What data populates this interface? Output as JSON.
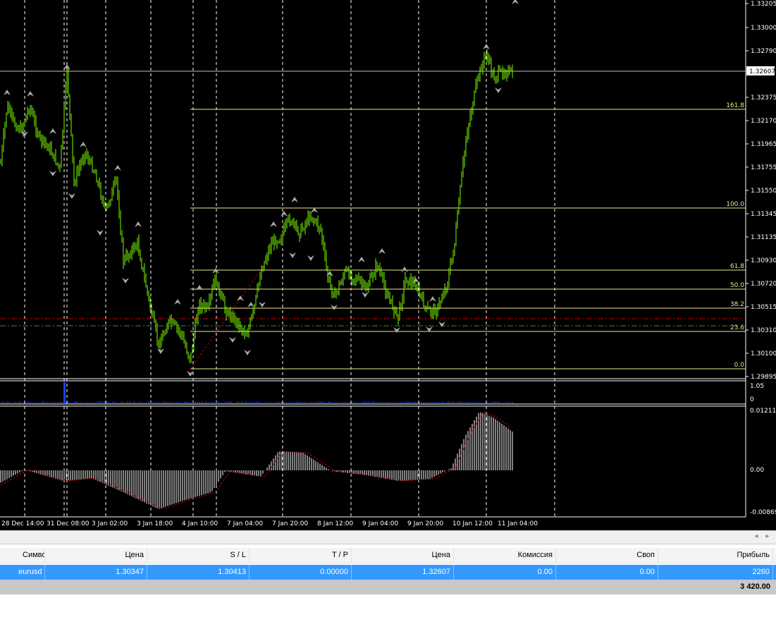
{
  "chart": {
    "price_axis_labels": [
      "1.33205",
      "1.33000",
      "1.32790",
      "1.32375",
      "1.32170",
      "1.31965",
      "1.31755",
      "1.31550",
      "1.31345",
      "1.31135",
      "1.30930",
      "1.30720",
      "1.30515",
      "1.30310",
      "1.30100",
      "1.29895"
    ],
    "current_price": "1.32607",
    "volume_axis_labels": [
      "1.05",
      "0"
    ],
    "indicator_axis_labels": [
      "0.012113",
      "0.00",
      "-0.00869"
    ],
    "time_axis_labels": [
      "28 Dec 14:00",
      "31 Dec 08:00",
      "3 Jan 02:00",
      "3 Jan 18:00",
      "4 Jan 10:00",
      "7 Jan 04:00",
      "7 Jan 20:00",
      "8 Jan 12:00",
      "9 Jan 04:00",
      "9 Jan 20:00",
      "10 Jan 12:00",
      "11 Jan 04:00"
    ],
    "fibonacci_levels": [
      "161.8",
      "100.0",
      "61.8",
      "50.0",
      "38.2",
      "23.6",
      "0.0"
    ],
    "colors": {
      "background": "#000000",
      "candles": "#7cfc00",
      "grid": "#ffffff",
      "fib": "#f0e68c",
      "macd_bars": "#ffffff",
      "signal": "#cc0000",
      "selected_row": "#3399ff"
    }
  },
  "scrollbar": {
    "left_icon": "arrow-left-icon",
    "right_icon": "arrow-right-icon",
    "left_glyph": "◂",
    "right_glyph": "▸"
  },
  "terminal": {
    "columns": [
      "Символ",
      "Цена",
      "S / L",
      "T / P",
      "Цена",
      "Комиссия",
      "Своп",
      "Прибыль"
    ],
    "positions": [
      {
        "symbol": "eurusd",
        "open_price": "1.30347",
        "sl": "1.30413",
        "tp": "0.00000",
        "price": "1.32607",
        "commission": "0.00",
        "swap": "0.00",
        "profit": "2260"
      }
    ],
    "total": "3 420.00"
  }
}
